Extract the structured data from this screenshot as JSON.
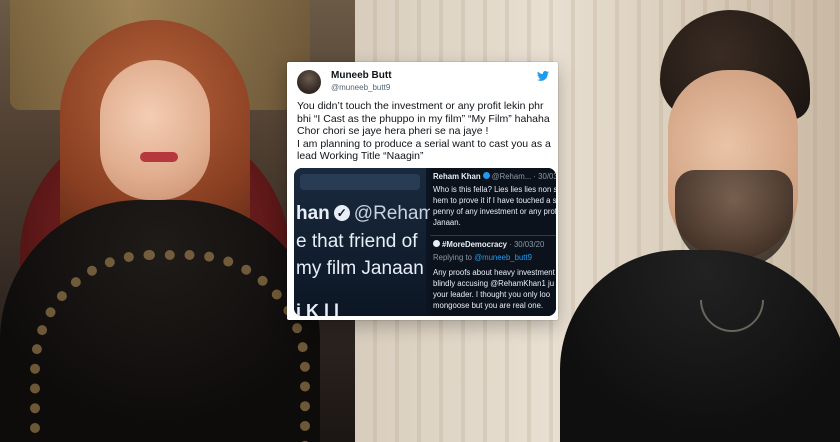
{
  "tweet": {
    "author_name": "Muneeb Butt",
    "author_handle": "@muneeb_butt9",
    "lines": [
      "You didn’t touch the investment or any profit lekin phr",
      "bhi “I Cast as the phuppo in my film” “My Film” hahaha",
      "Chor chori se jaye hera pheri se na jaye !",
      "I am planning to produce a serial want to cast you as a",
      "lead Working Title “Naagin”"
    ]
  },
  "media": {
    "left": {
      "name": "han",
      "handle": "@Reham",
      "line2": "e that friend of",
      "line3": "my film Janaan",
      "line4": "i K   l   l"
    },
    "right": {
      "r1_name": "Reham Khan",
      "r1_meta": "@Reham... · 30/03",
      "r1_lines": [
        "Who is this fella? Lies lies lies non s",
        "hem to prove it if I have touched a s",
        "penny of any investment or any prof",
        "Janaan."
      ],
      "r2_name": "#MoreDemocracy",
      "r2_meta": "· 30/03/20",
      "r2_reply_prefix": "Replying to",
      "r2_reply_handle": "@muneeb_butt9",
      "r2_lines": [
        "Any proofs about heavy investment",
        "blindly accusing @RehamKhan1 ju",
        "your leader. I thought you only loo",
        "mongoose but you are real one."
      ]
    }
  },
  "icons": {
    "bird": "twitter-bird-icon",
    "verified": "verified-badge-icon"
  },
  "colors": {
    "link_blue": "#1d9bf0",
    "dark_media_bg": "#0b121c"
  }
}
